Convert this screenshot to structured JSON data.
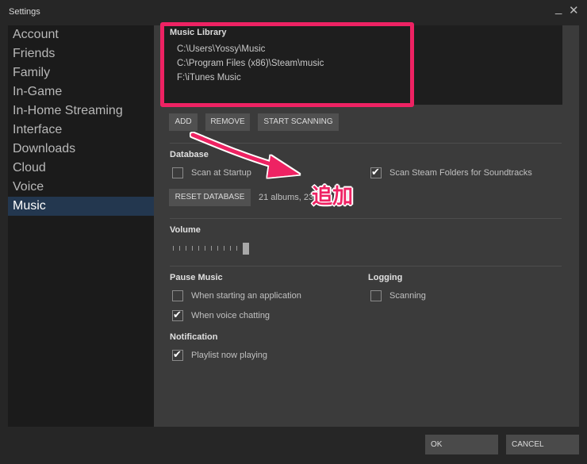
{
  "window": {
    "title": "Settings",
    "minimize_glyph": "_",
    "close_glyph": "✕"
  },
  "sidebar": {
    "items": [
      {
        "label": "Account"
      },
      {
        "label": "Friends"
      },
      {
        "label": "Family"
      },
      {
        "label": "In-Game"
      },
      {
        "label": "In-Home Streaming"
      },
      {
        "label": "Interface"
      },
      {
        "label": "Downloads"
      },
      {
        "label": "Cloud"
      },
      {
        "label": "Voice"
      },
      {
        "label": "Music",
        "active": true
      }
    ]
  },
  "library": {
    "title": "Music Library",
    "paths": [
      "C:\\Users\\Yossy\\Music",
      "C:\\Program Files (x86)\\Steam\\music",
      "F:\\iTunes Music"
    ],
    "buttons": {
      "add": "ADD",
      "remove": "REMOVE",
      "scan": "START SCANNING"
    }
  },
  "database": {
    "title": "Database",
    "scan_at_startup": {
      "label": "Scan at Startup",
      "checked": false
    },
    "scan_steam_folders": {
      "label": "Scan Steam Folders for Soundtracks",
      "checked": true
    },
    "reset_button": "RESET DATABASE",
    "stats": "21 albums, 23"
  },
  "volume": {
    "title": "Volume",
    "level": 1.0
  },
  "pause_music": {
    "title": "Pause Music",
    "when_starting_app": {
      "label": "When starting an application",
      "checked": false
    },
    "when_voice_chatting": {
      "label": "When voice chatting",
      "checked": true
    }
  },
  "logging": {
    "title": "Logging",
    "scanning": {
      "label": "Scanning",
      "checked": false
    }
  },
  "notification": {
    "title": "Notification",
    "playlist_now_playing": {
      "label": "Playlist now playing",
      "checked": true
    }
  },
  "annotation": {
    "text": "追加",
    "color": "#ee2263"
  },
  "footer": {
    "ok": "OK",
    "cancel": "CANCEL"
  },
  "colors": {
    "accent": "#ee2263",
    "selected_bg": "#23374f"
  }
}
